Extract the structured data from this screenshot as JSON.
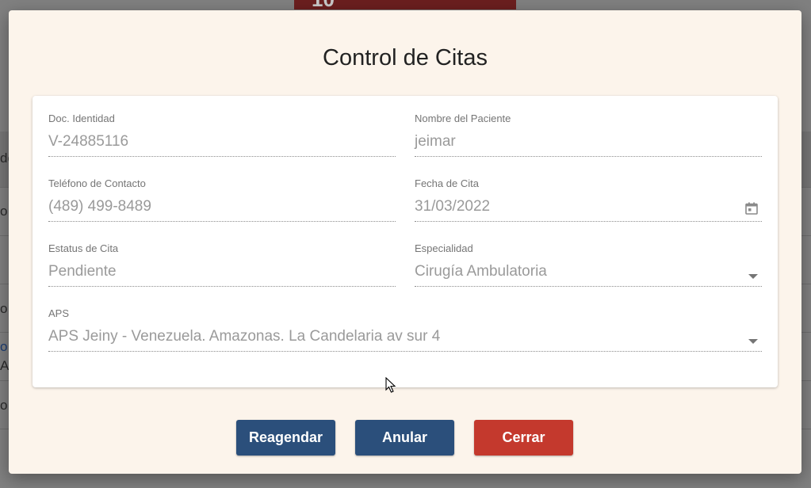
{
  "background": {
    "tab_number": "10",
    "row_fragments": [
      "de",
      "o",
      "o",
      "o I",
      "A",
      "o"
    ]
  },
  "modal": {
    "title": "Control de Citas",
    "fields": {
      "doc_identidad": {
        "label": "Doc. Identidad",
        "value": "V-24885116"
      },
      "nombre_paciente": {
        "label": "Nombre del Paciente",
        "value": "jeimar"
      },
      "telefono": {
        "label": "Teléfono de Contacto",
        "value": "(489) 499-8489"
      },
      "fecha_cita": {
        "label": "Fecha de Cita",
        "value": "31/03/2022",
        "icon": "calendar-icon"
      },
      "estatus_cita": {
        "label": "Estatus de Cita",
        "value": "Pendiente"
      },
      "especialidad": {
        "label": "Especialidad",
        "value": "Cirugía Ambulatoria",
        "icon": "chevron-down-icon"
      },
      "aps": {
        "label": "APS",
        "value": "APS Jeiny - Venezuela. Amazonas. La Candelaria av sur 4",
        "icon": "chevron-down-icon"
      }
    },
    "buttons": {
      "reagendar": "Reagendar",
      "anular": "Anular",
      "cerrar": "Cerrar"
    }
  },
  "colors": {
    "primary_button": "#2b4f7b",
    "danger_button": "#c4392d",
    "modal_background": "#fcf4eb"
  }
}
